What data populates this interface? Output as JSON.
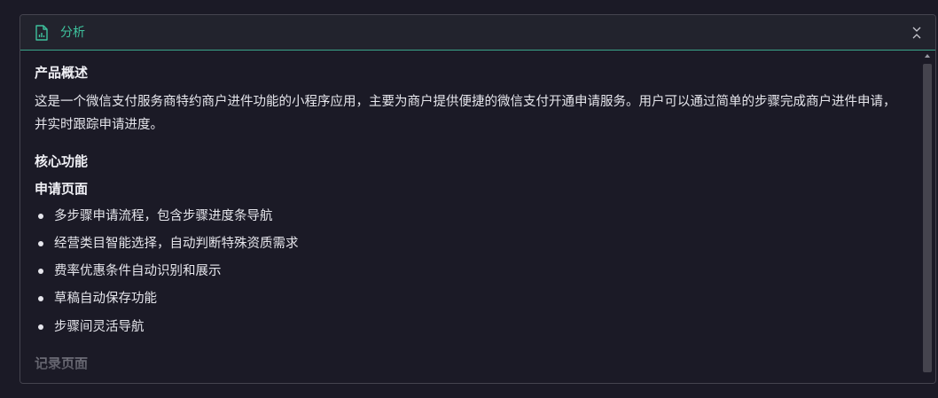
{
  "panel": {
    "title": "分析",
    "header_icon": "chart-document-icon",
    "collapse_icon": "collapse-chevrons-icon"
  },
  "content": {
    "overview_heading": "产品概述",
    "overview_text": "这是一个微信支付服务商特约商户进件功能的小程序应用，主要为商户提供便捷的微信支付开通申请服务。用户可以通过简单的步骤完成商户进件申请，并实时跟踪申请进度。",
    "core_heading": "核心功能",
    "apply_heading": "申请页面",
    "apply_items": [
      "多步骤申请流程，包含步骤进度条导航",
      "经营类目智能选择，自动判断特殊资质需求",
      "费率优惠条件自动识别和展示",
      "草稿自动保存功能",
      "步骤间灵活导航"
    ],
    "record_heading": "记录页面"
  },
  "colors": {
    "accent": "#3ec29d",
    "background": "#1b1a26",
    "header_bg": "#22232d",
    "text": "#e6e6ec",
    "border": "#45444f"
  }
}
